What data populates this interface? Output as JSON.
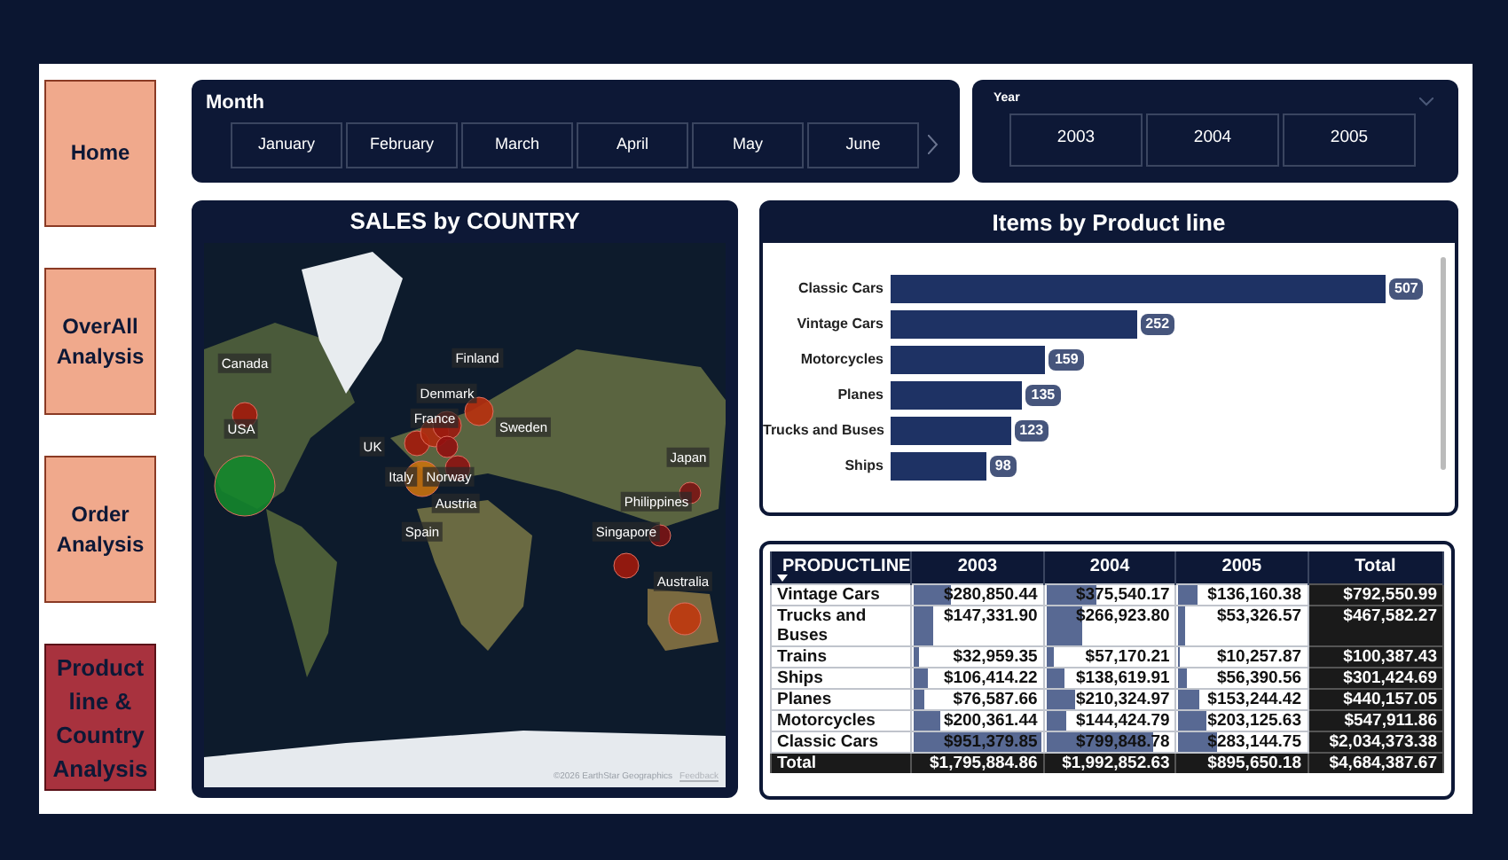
{
  "nav": [
    {
      "label": "Home",
      "selected": false
    },
    {
      "label": "OverAll Analysis",
      "selected": false
    },
    {
      "label": "Order Analysis",
      "selected": false
    },
    {
      "label": "Product line & Country Analysis",
      "selected": true
    }
  ],
  "month_slicer": {
    "title": "Month",
    "options": [
      "January",
      "February",
      "March",
      "April",
      "May",
      "June"
    ]
  },
  "year_slicer": {
    "title": "Year",
    "options": [
      "2003",
      "2004",
      "2005"
    ]
  },
  "map": {
    "title": "SALES by COUNTRY",
    "labels": [
      "Canada",
      "Finland",
      "Denmark",
      "France",
      "Sweden",
      "USA",
      "UK",
      "Japan",
      "Italy",
      "Norway",
      "Austria",
      "Philippines",
      "Spain",
      "Singapore",
      "Australia"
    ],
    "attribution": "©2026 EarthStar Geographics",
    "feedback": "Feedback"
  },
  "product_chart": {
    "title": "Items by Product line",
    "chart_data": {
      "type": "bar",
      "orientation": "horizontal",
      "data_labels": true,
      "categories": [
        "Classic Cars",
        "Vintage Cars",
        "Motorcycles",
        "Planes",
        "Trucks and Buses",
        "Ships"
      ],
      "values": [
        507,
        252,
        159,
        135,
        123,
        98
      ]
    }
  },
  "matrix": {
    "columns": [
      "PRODUCTLINE",
      "2003",
      "2004",
      "2005",
      "Total"
    ],
    "rows": [
      [
        "Vintage Cars",
        "$280,850.44",
        "$375,540.17",
        "$136,160.38",
        "$792,550.99"
      ],
      [
        "Trucks and Buses",
        "$147,331.90",
        "$266,923.80",
        "$53,326.57",
        "$467,582.27"
      ],
      [
        "Trains",
        "$32,959.35",
        "$57,170.21",
        "$10,257.87",
        "$100,387.43"
      ],
      [
        "Ships",
        "$106,414.22",
        "$138,619.91",
        "$56,390.56",
        "$301,424.69"
      ],
      [
        "Planes",
        "$76,587.66",
        "$210,324.97",
        "$153,244.42",
        "$440,157.05"
      ],
      [
        "Motorcycles",
        "$200,361.44",
        "$144,424.79",
        "$203,125.63",
        "$547,911.86"
      ],
      [
        "Classic Cars",
        "$951,379.85",
        "$799,848.78",
        "$283,144.75",
        "$2,034,373.38"
      ]
    ],
    "total": [
      "Total",
      "$1,795,884.86",
      "$1,992,852.63",
      "$895,650.18",
      "$4,684,387.67"
    ]
  }
}
